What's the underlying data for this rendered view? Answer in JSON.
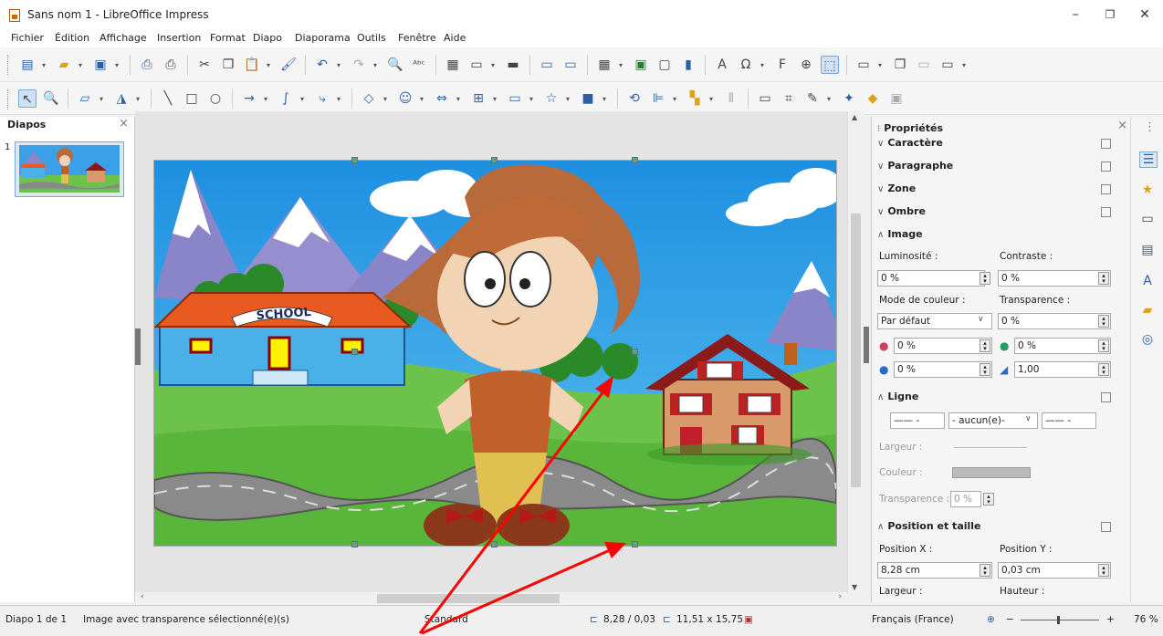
{
  "window": {
    "title": "Sans nom 1 - LibreOffice Impress",
    "minimize": "–",
    "restore": "❐",
    "close": "✕"
  },
  "menu": [
    "Fichier",
    "Édition",
    "Affichage",
    "Insertion",
    "Format",
    "Diapo",
    "Diaporama",
    "Outils",
    "Fenêtre",
    "Aide"
  ],
  "slides_pane": {
    "title": "Diapos",
    "close": "×",
    "slide_number": "1"
  },
  "sidebar": {
    "title": "Propriétés",
    "close": "×",
    "menu": "⋮",
    "sections": {
      "caractere": "Caractère",
      "paragraphe": "Paragraphe",
      "zone": "Zone",
      "ombre": "Ombre",
      "image": "Image",
      "ligne": "Ligne",
      "position": "Position et taille"
    },
    "image": {
      "luminosite_label": "Luminosité :",
      "luminosite_value": "0 %",
      "contraste_label": "Contraste :",
      "contraste_value": "0 %",
      "mode_label": "Mode de couleur :",
      "mode_value": "Par défaut",
      "transparence_label": "Transparence :",
      "transparence_value": "0 %",
      "red_value": "0 %",
      "green_value": "0 %",
      "blue_value": "0 %",
      "gamma_value": "1,00"
    },
    "ligne": {
      "arrow_style": "- aucun(e)-",
      "largeur_label": "Largeur :",
      "couleur_label": "Couleur :",
      "transparence_label": "Transparence :",
      "transparence_value": "0 %"
    },
    "position": {
      "pos_x_label": "Position X :",
      "pos_x_value": "8,28 cm",
      "pos_y_label": "Position Y :",
      "pos_y_value": "0,03 cm",
      "largeur_label": "Largeur :",
      "hauteur_label": "Hauteur :"
    }
  },
  "slide": {
    "school_sign": "SCHOOL"
  },
  "status": {
    "slide_info": "Diapo 1 de 1",
    "selection": "Image avec transparence sélectionné(e)(s)",
    "master": "Standard",
    "position": "8,28 / 0,03",
    "size": "11,51 x 15,75",
    "language": "Français (France)",
    "zoom": "76 %"
  },
  "colors": {
    "accent": "#2a5fa5",
    "annotation_arrow": "#ff0000"
  }
}
